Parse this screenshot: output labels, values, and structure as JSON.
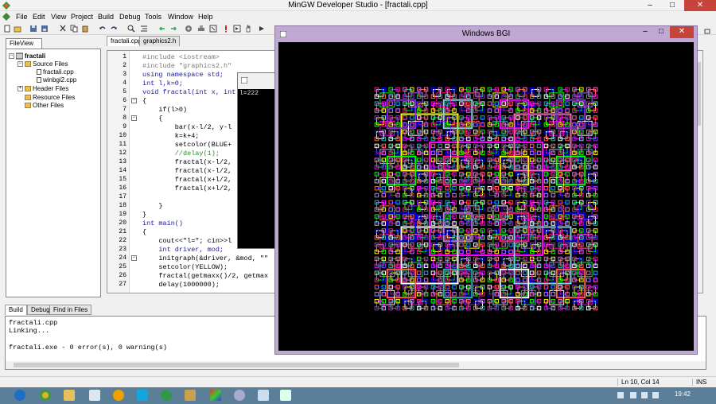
{
  "window": {
    "title": "MinGW Developer Studio - [fractali.cpp]",
    "minimize": "–",
    "maximize": "□",
    "close": "✕",
    "accent": "#c7443a"
  },
  "menu": [
    "File",
    "Edit",
    "View",
    "Project",
    "Build",
    "Debug",
    "Tools",
    "Window",
    "Help"
  ],
  "fileview": {
    "tab": "FileView",
    "project": "fractali",
    "source_files": "Source Files",
    "files": [
      "fractali.cpp",
      "winbgi2.cpp"
    ],
    "header_files": "Header Files",
    "resource_files": "Resource Files",
    "other_files": "Other Files"
  },
  "editor": {
    "tabs": [
      "fractali.cpp",
      "graphics2.h"
    ],
    "lines": [
      "#include <iostream>",
      "#include \"graphics2.h\"",
      "using namespace std;",
      "int l,k=0;",
      "void fractal(int x, int",
      "{",
      "    if(l>0)",
      "    {",
      "        bar(x-l/2, y-l",
      "        k=k+4;",
      "        setcolor(BLUE+",
      "        //delay(1);",
      "        fractal(x-l/2,",
      "        fractal(x-l/2,",
      "        fractal(x+l/2,",
      "        fractal(x+l/2,",
      "",
      "    }",
      "}",
      "int main()",
      "{",
      "    cout<<\"l=\"; cin>>l",
      "    int driver, mod;",
      "    initgraph(&driver, &mod, \"\"",
      "    setcolor(YELLOW);",
      "    fractal(getmaxx()/2, getmax",
      "    delay(1000000);"
    ],
    "line_numbers": [
      "1",
      "2",
      "3",
      "4",
      "5",
      "6",
      "7",
      "8",
      "9",
      "10",
      "11",
      "12",
      "13",
      "14",
      "15",
      "16",
      "17",
      "18",
      "19",
      "20",
      "21",
      "22",
      "23",
      "24",
      "25",
      "26",
      "27"
    ]
  },
  "console": {
    "text": "l=222"
  },
  "output": {
    "tabs": [
      "Build",
      "Debug",
      "Find in Files"
    ],
    "lines": [
      "fractali.cpp",
      "Linking...",
      "",
      "fractali.exe - 0 error(s), 0 warning(s)"
    ]
  },
  "status": {
    "position": "Ln 10, Col 14",
    "mode": "INS"
  },
  "bgi": {
    "title": "Windows BGI",
    "close": "✕",
    "palette": [
      "#ff00ff",
      "#ffff00",
      "#8a2be2",
      "#00ff00",
      "#87ceeb",
      "#ff1493",
      "#ffffff",
      "#0000ff",
      "#ff6347",
      "#c070f0",
      "#20b2aa",
      "#ff69b4"
    ]
  },
  "taskbar": {
    "clock": "19:42",
    "color": "#5c7f99"
  }
}
